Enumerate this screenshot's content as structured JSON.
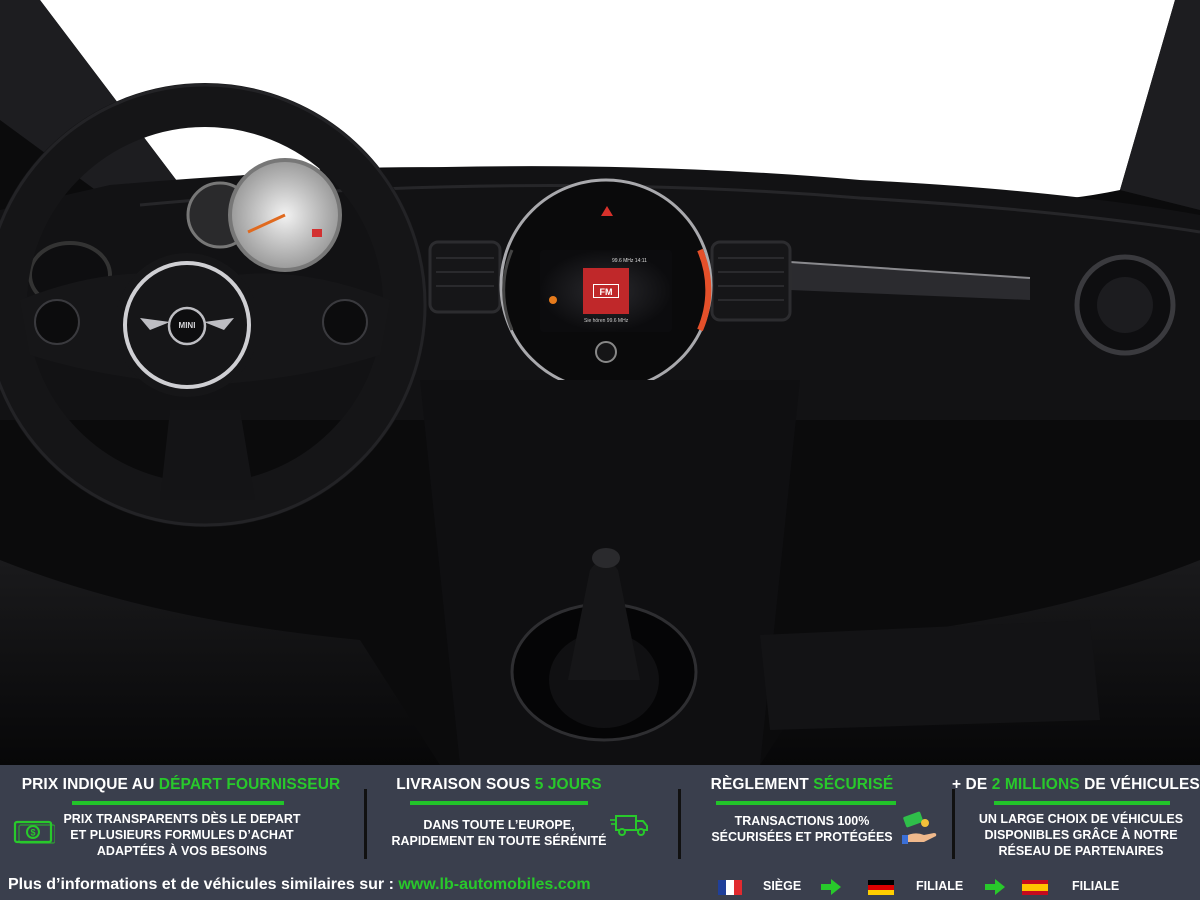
{
  "banner": {
    "col1": {
      "title_part1": "PRIX INDIQUE AU ",
      "title_part2": "DÉPART FOURNISSEUR",
      "line1": "PRIX TRANSPARENTS DÈS LE DEPART",
      "line2": "ET PLUSIEURS FORMULES D’ACHAT",
      "line3": "ADAPTÉES À VOS BESOINS",
      "icon": "money-icon"
    },
    "col2": {
      "title_part1": "LIVRAISON SOUS ",
      "title_part2": "5 JOURS",
      "line1": "DANS TOUTE L’EUROPE,",
      "line2": "RAPIDEMENT EN TOUTE SÉRÉNITÉ",
      "icon": "delivery-truck-icon"
    },
    "col3": {
      "title_part1": "RÈGLEMENT ",
      "title_part2": "SÉCURISÉ",
      "line1": "TRANSACTIONS 100%",
      "line2": "SÉCURISÉES ET PROTÉGÉES",
      "icon": "payment-hand-icon"
    },
    "col4": {
      "title_part1": "+ DE ",
      "title_part2": "2 MILLIONS",
      "title_part3": " DE VÉHICULES",
      "line1": "UN LARGE CHOIX DE VÉHICULES",
      "line2": "DISPONIBLES GRÂCE À NOTRE",
      "line3": "RÉSEAU DE PARTENAIRES"
    },
    "footer": {
      "text": "Plus d’informations et de véhicules similaires sur : ",
      "link": "www.lb-automobiles.com",
      "fr_label": "SIÈGE",
      "de_label": "FILIALE",
      "es_label": "FILIALE"
    }
  },
  "photo": {
    "steering_logo": "MINI",
    "screen_badge": "FM",
    "screen_status": "99.6 MHz  14:11",
    "screen_caption": "Sie hören 99.6 MHz"
  },
  "colors": {
    "banner_bg": "#3a3f4d",
    "accent_green": "#28c92b",
    "dash_dark": "#0b0b0c"
  }
}
